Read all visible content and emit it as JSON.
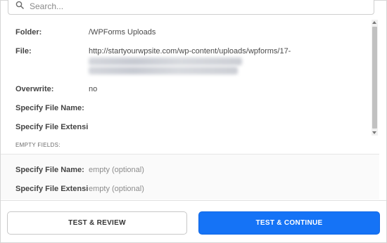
{
  "search": {
    "placeholder": "Search..."
  },
  "fields": [
    {
      "label": "Folder:",
      "value": "/WPForms Uploads"
    },
    {
      "label": "File:",
      "value": "http://startyourwpsite.com/wp-content/uploads/wpforms/17-"
    },
    {
      "label": "Overwrite:",
      "value": "no"
    },
    {
      "label": "Specify File Name:",
      "value": ""
    },
    {
      "label": "Specify File Extensi...",
      "value": ""
    }
  ],
  "empty_fields": {
    "title": "EMPTY FIELDS:",
    "items": [
      {
        "label": "Specify File Name:",
        "value": "empty (optional)"
      },
      {
        "label": "Specify File Extensi...",
        "value": "empty (optional)"
      }
    ]
  },
  "buttons": {
    "review": "TEST & REVIEW",
    "continue": "TEST & CONTINUE"
  },
  "colors": {
    "accent": "#1573f6"
  },
  "icons": {
    "search": "search-icon"
  }
}
